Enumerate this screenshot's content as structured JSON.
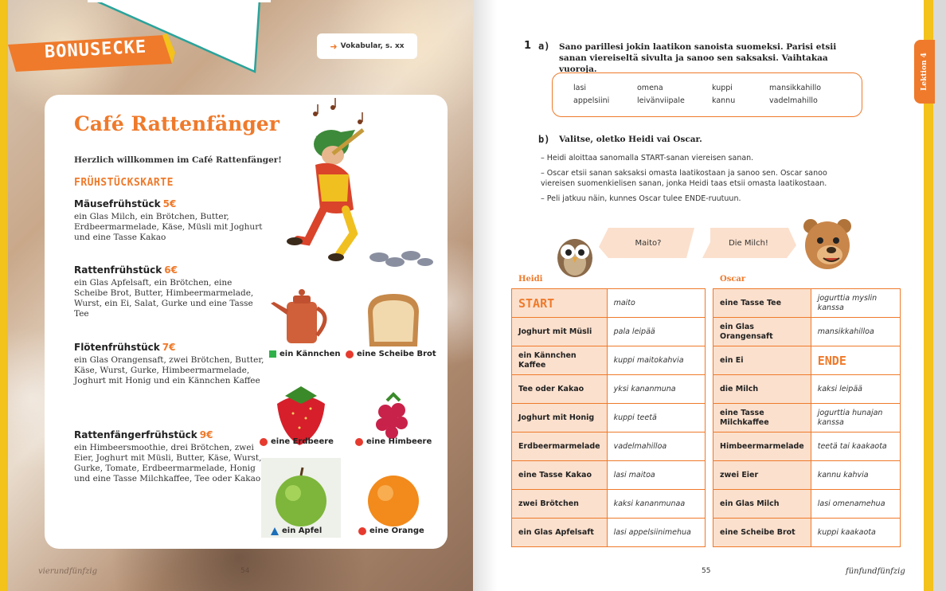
{
  "left": {
    "banner": "BONUSECKE",
    "vocab_ref": "Vokabular, s. xx",
    "cafe_title": "Café Rattenfänger",
    "welcome": "Herzlich willkommen im Café Rattenfänger!",
    "menu_heading": "FRÜHSTÜCKSKARTE",
    "menu": [
      {
        "name": "Mäusefrühstück",
        "price": "5€",
        "desc": "ein Glas Milch, ein Brötchen, Butter, Erdbeermarmelade, Käse, Müsli mit Joghurt und eine Tasse Kakao"
      },
      {
        "name": "Rattenfrühstück",
        "price": "6€",
        "desc": "ein Glas Apfelsaft, ein Brötchen, eine Scheibe Brot, Butter, Himbeermarmelade, Wurst, ein Ei, Salat, Gurke und eine Tasse Tee"
      },
      {
        "name": "Flötenfrühstück",
        "price": "7€",
        "desc": "ein Glas Orangensaft, zwei Brötchen, Butter, Käse, Wurst, Gurke, Himbeermarmelade, Joghurt mit Honig und ein Kännchen Kaffee"
      },
      {
        "name": "Rattenfängerfrühstück",
        "price": "9€",
        "desc": "ein Himbeersmoothie, drei Brötchen, zwei Eier, Joghurt mit Müsli, Butter, Käse, Wurst, Gurke, Tomate, Erdbeermarmelade, Honig und eine Tasse Milchkaffee, Tee oder Kakao"
      }
    ],
    "foods": [
      {
        "label": "ein Kännchen",
        "marker": "square",
        "color": "#2fb14a"
      },
      {
        "label": "eine Scheibe Brot",
        "marker": "dot",
        "color": "#e63a2e"
      },
      {
        "label": "eine Erdbeere",
        "marker": "dot",
        "color": "#e63a2e"
      },
      {
        "label": "eine Himbeere",
        "marker": "dot",
        "color": "#e63a2e"
      },
      {
        "label": "ein Apfel",
        "marker": "triangle",
        "color": "#1d6fb8"
      },
      {
        "label": "eine Orange",
        "marker": "dot",
        "color": "#e63a2e"
      }
    ],
    "footer_text": "vierundfünfzig",
    "footer_num": "54"
  },
  "right": {
    "lektion_tab": "Lektion 4",
    "task_number": "1",
    "task_a_letter": "a)",
    "task_a_text": "Sano parillesi jokin laatikon sanoista suomeksi. Parisi etsii sanan viereiseltä sivulta ja sanoo sen saksaksi. Vaihtakaa vuoroja.",
    "words": [
      "lasi",
      "omena",
      "kuppi",
      "mansikkahillo",
      "appelsiini",
      "leivänviipale",
      "kannu",
      "vadelmahillo"
    ],
    "task_b_letter": "b)",
    "task_b_text": "Valitse, oletko Heidi vai Oscar.",
    "rules": [
      "– Heidi aloittaa sanomalla START-sanan viereisen sanan.",
      "– Oscar etsii sanan saksaksi omasta laatikostaan ja sanoo sen. Oscar sanoo viereisen suomenkielisen sanan, jonka Heidi taas etsii omasta laatikostaan.",
      "– Peli jatkuu näin, kunnes Oscar tulee ENDE-ruutuun."
    ],
    "bubble_heidi": "Maito?",
    "bubble_oscar": "Die Milch!",
    "label_heidi": "Heidi",
    "label_oscar": "Oscar",
    "heidi_table": [
      {
        "de": "START",
        "fi": "maito"
      },
      {
        "de": "Joghurt mit Müsli",
        "fi": "pala leipää"
      },
      {
        "de": "ein Kännchen Kaffee",
        "fi": "kuppi maitokahvia"
      },
      {
        "de": "Tee oder Kakao",
        "fi": "yksi kananmuna"
      },
      {
        "de": "Joghurt mit Honig",
        "fi": "kuppi teetä"
      },
      {
        "de": "Erdbeermarmelade",
        "fi": "vadelmahilloa"
      },
      {
        "de": "eine Tasse Kakao",
        "fi": "lasi maitoa"
      },
      {
        "de": "zwei Brötchen",
        "fi": "kaksi kananmunaa"
      },
      {
        "de": "ein Glas Apfelsaft",
        "fi": "lasi appelsiinimehua"
      }
    ],
    "oscar_table": [
      {
        "de": "eine Tasse Tee",
        "fi": "jogurttia myslin kanssa"
      },
      {
        "de": "ein Glas Orangensaft",
        "fi": "mansikkahilloa"
      },
      {
        "de": "ein Ei",
        "fi": "ENDE"
      },
      {
        "de": "die Milch",
        "fi": "kaksi leipää"
      },
      {
        "de": "eine Tasse Milchkaffee",
        "fi": "jogurttia hunajan kanssa"
      },
      {
        "de": "Himbeermarmelade",
        "fi": "teetä tai kaakaota"
      },
      {
        "de": "zwei Eier",
        "fi": "kannu kahvia"
      },
      {
        "de": "ein Glas Milch",
        "fi": "lasi omenamehua"
      },
      {
        "de": "eine Scheibe Brot",
        "fi": "kuppi kaakaota"
      }
    ],
    "footer_num": "55",
    "footer_text": "fünfundfünfzig"
  },
  "colors": {
    "accent": "#ef7a2b",
    "accent_light": "#fbe0cd",
    "yellow": "#f3c21b",
    "teal": "#2aa39b"
  }
}
